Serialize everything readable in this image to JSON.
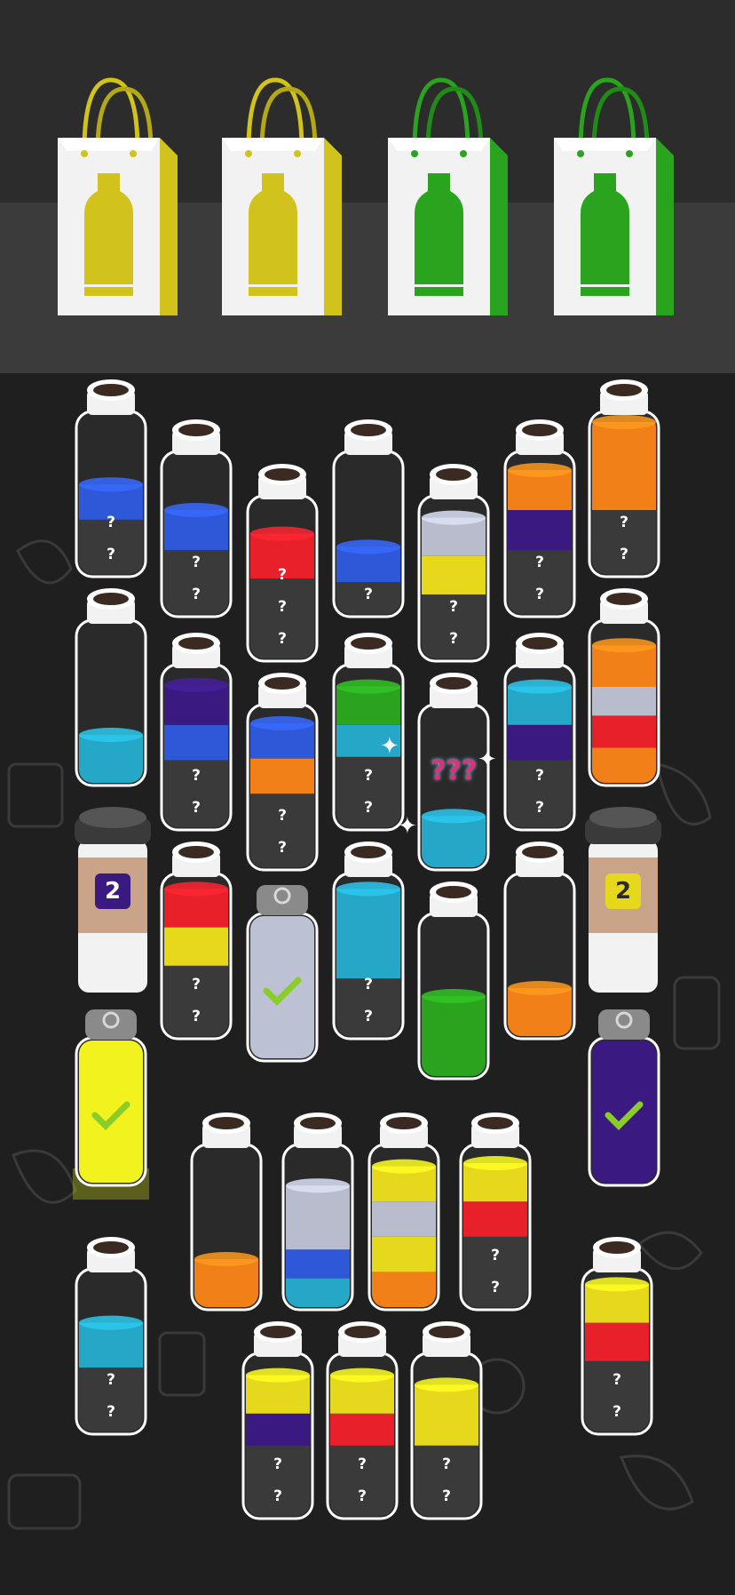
{
  "bags": [
    {
      "color": "#d2c21c",
      "accent": "#b4a814"
    },
    {
      "color": "#d2c21c",
      "accent": "#b4a814"
    },
    {
      "color": "#2aa41e",
      "accent": "#1f8c16"
    },
    {
      "color": "#2aa41e",
      "accent": "#1f8c16"
    }
  ],
  "bottles": [
    {
      "id": "b1",
      "layers": [
        {
          "c": "#2f58d8",
          "f": 0.22
        },
        {
          "c": "#3a3a3a",
          "f": 0.34
        }
      ],
      "hidden": 2
    },
    {
      "id": "b2",
      "layers": [
        {
          "c": "#2f58d8",
          "f": 0.25
        },
        {
          "c": "#3a3a3a",
          "f": 0.4
        }
      ],
      "hidden": 2
    },
    {
      "id": "b3",
      "layers": [
        {
          "c": "#e8202a",
          "f": 0.28
        },
        {
          "c": "#3a3a3a",
          "f": 0.5
        }
      ],
      "hidden": 3
    },
    {
      "id": "b4",
      "layers": [
        {
          "c": "#2f58d8",
          "f": 0.22
        },
        {
          "c": "#3a3a3a",
          "f": 0.2
        }
      ],
      "hidden": 1
    },
    {
      "id": "b5",
      "layers": [
        {
          "c": "#b8bccc",
          "f": 0.24
        },
        {
          "c": "#e6d81c",
          "f": 0.24
        },
        {
          "c": "#3a3a3a",
          "f": 0.4
        }
      ],
      "hidden": 2
    },
    {
      "id": "b6",
      "layers": [
        {
          "c": "#f28018",
          "f": 0.25
        },
        {
          "c": "#3a1a80",
          "f": 0.25
        },
        {
          "c": "#3a3a3a",
          "f": 0.4
        }
      ],
      "hidden": 2
    },
    {
      "id": "b7",
      "layers": [
        {
          "c": "#f28018",
          "f": 0.55
        },
        {
          "c": "#3a3a3a",
          "f": 0.4
        }
      ],
      "hidden": 2
    },
    {
      "id": "b8",
      "layers": [
        {
          "c": "#25a8c8",
          "f": 0.3
        }
      ],
      "hidden": 0
    },
    {
      "id": "b9",
      "layers": [
        {
          "c": "#3a1a80",
          "f": 0.25
        },
        {
          "c": "#2f58d8",
          "f": 0.22
        },
        {
          "c": "#3a3a3a",
          "f": 0.42
        }
      ],
      "hidden": 2
    },
    {
      "id": "b10",
      "layers": [
        {
          "c": "#2f58d8",
          "f": 0.22
        },
        {
          "c": "#f28018",
          "f": 0.22
        },
        {
          "c": "#3a3a3a",
          "f": 0.46
        }
      ],
      "hidden": 2
    },
    {
      "id": "b11",
      "layers": [
        {
          "c": "#2aa41e",
          "f": 0.24
        },
        {
          "c": "#25a8c8",
          "f": 0.2
        },
        {
          "c": "#3a3a3a",
          "f": 0.44
        }
      ],
      "hidden": 2
    },
    {
      "id": "b12",
      "mystery": true,
      "layers": [
        {
          "c": "#25a8c8",
          "f": 0.32
        }
      ],
      "hidden": 0
    },
    {
      "id": "b13",
      "layers": [
        {
          "c": "#25a8c8",
          "f": 0.24
        },
        {
          "c": "#3a1a80",
          "f": 0.22
        },
        {
          "c": "#3a3a3a",
          "f": 0.42
        }
      ],
      "hidden": 2
    },
    {
      "id": "b14",
      "layers": [
        {
          "c": "#f28018",
          "f": 0.26
        },
        {
          "c": "#b8bccc",
          "f": 0.18
        },
        {
          "c": "#e8202a",
          "f": 0.2
        },
        {
          "c": "#f28018",
          "f": 0.22
        }
      ],
      "hidden": 0
    },
    {
      "id": "b15",
      "layers": [
        {
          "c": "#e8202a",
          "f": 0.24
        },
        {
          "c": "#e6d81c",
          "f": 0.24
        },
        {
          "c": "#3a3a3a",
          "f": 0.44
        }
      ],
      "hidden": 2
    },
    {
      "id": "b16",
      "capped": true,
      "done": true,
      "layers": [
        {
          "c": "#bcc2d4",
          "f": 1.0
        }
      ],
      "hidden": 0
    },
    {
      "id": "b17",
      "layers": [
        {
          "c": "#25a8c8",
          "f": 0.56
        },
        {
          "c": "#3a3a3a",
          "f": 0.36
        }
      ],
      "hidden": 2
    },
    {
      "id": "b18",
      "layers": [
        {
          "c": "#2aa41e",
          "f": 0.5
        }
      ],
      "hidden": 0
    },
    {
      "id": "b19",
      "layers": [
        {
          "c": "#f28018",
          "f": 0.3
        }
      ],
      "hidden": 0
    },
    {
      "id": "b20",
      "capped": true,
      "done": true,
      "glow": true,
      "layers": [
        {
          "c": "#f2f21e",
          "f": 1.0
        }
      ],
      "hidden": 0
    },
    {
      "id": "b21",
      "capped": true,
      "done": true,
      "layers": [
        {
          "c": "#3a1a80",
          "f": 1.0
        }
      ],
      "hidden": 0
    },
    {
      "id": "b22",
      "layers": [
        {
          "c": "#f28018",
          "f": 0.3
        }
      ],
      "hidden": 0
    },
    {
      "id": "b23",
      "layers": [
        {
          "c": "#b8bccc",
          "f": 0.4
        },
        {
          "c": "#2f58d8",
          "f": 0.18
        },
        {
          "c": "#25a8c8",
          "f": 0.18
        }
      ],
      "hidden": 0
    },
    {
      "id": "b24",
      "layers": [
        {
          "c": "#e6d81c",
          "f": 0.22
        },
        {
          "c": "#b8bccc",
          "f": 0.22
        },
        {
          "c": "#e6d81c",
          "f": 0.22
        },
        {
          "c": "#f28018",
          "f": 0.22
        }
      ],
      "hidden": 0
    },
    {
      "id": "b25",
      "layers": [
        {
          "c": "#e6d81c",
          "f": 0.24
        },
        {
          "c": "#e8202a",
          "f": 0.22
        },
        {
          "c": "#3a3a3a",
          "f": 0.44
        }
      ],
      "hidden": 2
    },
    {
      "id": "b26",
      "layers": [
        {
          "c": "#25a8c8",
          "f": 0.28
        },
        {
          "c": "#3a3a3a",
          "f": 0.4
        }
      ],
      "hidden": 2
    },
    {
      "id": "b27",
      "layers": [
        {
          "c": "#e6d81c",
          "f": 0.24
        },
        {
          "c": "#3a1a80",
          "f": 0.2
        },
        {
          "c": "#3a3a3a",
          "f": 0.44
        }
      ],
      "hidden": 2
    },
    {
      "id": "b28",
      "layers": [
        {
          "c": "#e6d81c",
          "f": 0.24
        },
        {
          "c": "#e8202a",
          "f": 0.2
        },
        {
          "c": "#3a3a3a",
          "f": 0.44
        }
      ],
      "hidden": 2
    },
    {
      "id": "b29",
      "layers": [
        {
          "c": "#e6d81c",
          "f": 0.38
        },
        {
          "c": "#3a3a3a",
          "f": 0.44
        }
      ],
      "hidden": 2
    },
    {
      "id": "b30",
      "layers": [
        {
          "c": "#e6d81c",
          "f": 0.24
        },
        {
          "c": "#e8202a",
          "f": 0.24
        },
        {
          "c": "#3a3a3a",
          "f": 0.44
        }
      ],
      "hidden": 2
    }
  ],
  "cups": [
    {
      "id": "cup1",
      "count": "2",
      "badge_bg": "#3a1a80",
      "badge_fg": "#ffffff"
    },
    {
      "id": "cup2",
      "count": "2",
      "badge_bg": "#e6d81c",
      "badge_fg": "#2a2a2a"
    }
  ],
  "mystery_label": "???",
  "hidden_mark": "?"
}
